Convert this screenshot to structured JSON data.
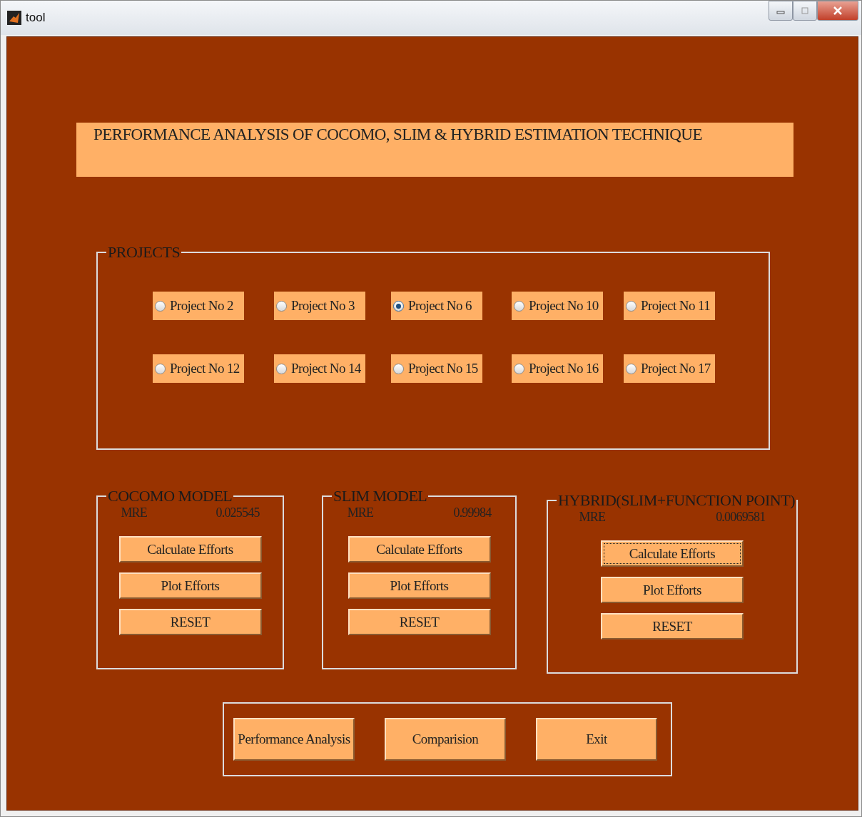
{
  "window": {
    "title": "tool"
  },
  "banner": {
    "text": "PERFORMANCE ANALYSIS OF COCOMO, SLIM & HYBRID ESTIMATION TECHNIQUE"
  },
  "projects": {
    "title": "PROJECTS",
    "items": [
      {
        "label": "Project No 2",
        "selected": false
      },
      {
        "label": "Project No 3",
        "selected": false
      },
      {
        "label": "Project No 6",
        "selected": true
      },
      {
        "label": "Project No 10",
        "selected": false
      },
      {
        "label": "Project No 11",
        "selected": false
      },
      {
        "label": "Project No 12",
        "selected": false
      },
      {
        "label": "Project No 14",
        "selected": false
      },
      {
        "label": "Project No 15",
        "selected": false
      },
      {
        "label": "Project No 16",
        "selected": false
      },
      {
        "label": "Project No 17",
        "selected": false
      }
    ]
  },
  "models": [
    {
      "title": "COCOMO MODEL",
      "mre_label": "MRE",
      "mre_value": "0.025545",
      "buttons": [
        {
          "label": "Calculate Efforts",
          "focused": false
        },
        {
          "label": "Plot Efforts",
          "focused": false
        },
        {
          "label": "RESET",
          "focused": false
        }
      ]
    },
    {
      "title": "SLIM MODEL",
      "mre_label": "MRE",
      "mre_value": "0.99984",
      "buttons": [
        {
          "label": "Calculate Efforts",
          "focused": false
        },
        {
          "label": "Plot Efforts",
          "focused": false
        },
        {
          "label": "RESET",
          "focused": false
        }
      ]
    },
    {
      "title": "HYBRID(SLIM+FUNCTION POINT)",
      "mre_label": "MRE",
      "mre_value": "0.0069581",
      "buttons": [
        {
          "label": "Calculate Efforts",
          "focused": true
        },
        {
          "label": "Plot Efforts",
          "focused": false
        },
        {
          "label": "RESET",
          "focused": false
        }
      ]
    }
  ],
  "actions": [
    {
      "label": "Performance Analysis"
    },
    {
      "label": "Comparision"
    },
    {
      "label": "Exit"
    }
  ]
}
